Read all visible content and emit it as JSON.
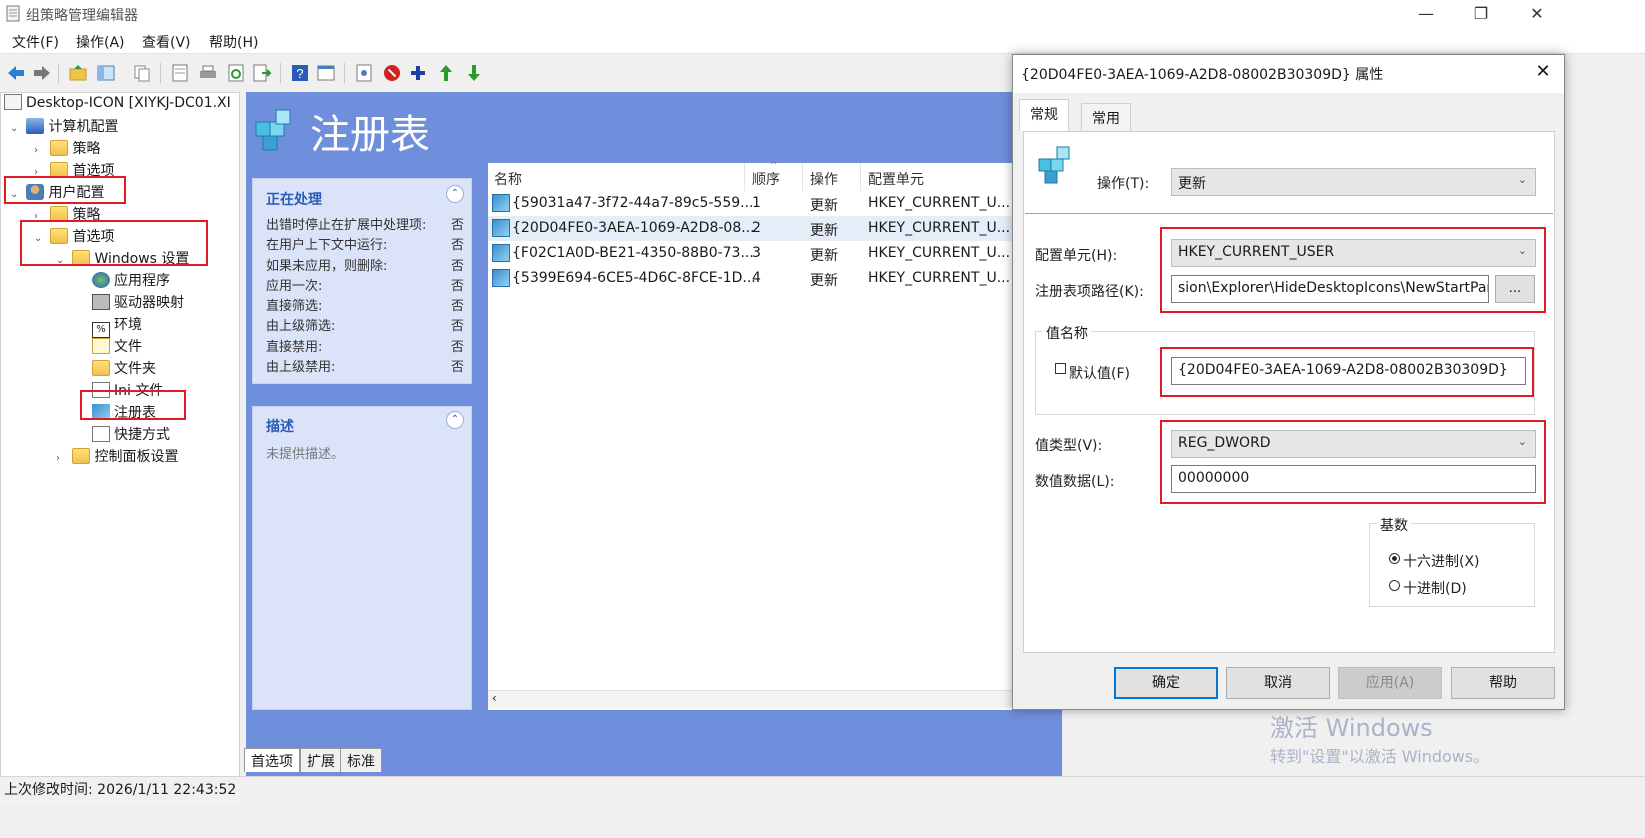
{
  "window": {
    "title": "组策略管理编辑器",
    "minimize": "—",
    "restore": "❐",
    "close": "✕"
  },
  "menu": [
    "文件(F)",
    "操作(A)",
    "查看(V)",
    "帮助(H)"
  ],
  "toolbar_icons": [
    "back-arrow-icon",
    "forward-arrow-icon",
    "up-folder-icon",
    "show-hide-tree-icon",
    "copy-icon",
    "properties-icon",
    "print-icon",
    "refresh-icon",
    "export-icon",
    "help-icon",
    "view-icon",
    "document-properties-icon",
    "stop-icon",
    "add-icon",
    "move-up-icon",
    "move-down-icon"
  ],
  "tree": {
    "root": "Desktop-ICON [XIYKJ-DC01.XI",
    "computer_config": "计算机配置",
    "cc_policies": "策略",
    "cc_prefs": "首选项",
    "user_config": "用户配置",
    "uc_policies": "策略",
    "uc_prefs": "首选项",
    "windows_settings": "Windows 设置",
    "applications": "应用程序",
    "drive_maps": "驱动器映射",
    "environment": "环境",
    "files": "文件",
    "folders": "文件夹",
    "ini_files": "Ini 文件",
    "registry": "注册表",
    "shortcuts": "快捷方式",
    "control_panel": "控制面板设置"
  },
  "main": {
    "title": "注册表",
    "processing": {
      "header": "正在处理",
      "rows": [
        {
          "label": "出错时停止在扩展中处理项:",
          "value": "否"
        },
        {
          "label": "在用户上下文中运行:",
          "value": "否"
        },
        {
          "label": "如果未应用，则删除:",
          "value": "否"
        },
        {
          "label": "应用一次:",
          "value": "否"
        },
        {
          "label": "直接筛选:",
          "value": "否"
        },
        {
          "label": "由上级筛选:",
          "value": "否"
        },
        {
          "label": "直接禁用:",
          "value": "否"
        },
        {
          "label": "由上级禁用:",
          "value": "否"
        }
      ]
    },
    "description": {
      "header": "描述",
      "text": "未提供描述。"
    },
    "list": {
      "columns": [
        "名称",
        "顺序",
        "操作",
        "配置单元"
      ],
      "rows": [
        {
          "name": "{59031a47-3f72-44a7-89c5-559...",
          "order": "1",
          "action": "更新",
          "hive": "HKEY_CURRENT_U..."
        },
        {
          "name": "{20D04FE0-3AEA-1069-A2D8-08...",
          "order": "2",
          "action": "更新",
          "hive": "HKEY_CURRENT_U..."
        },
        {
          "name": "{F02C1A0D-BE21-4350-88B0-73...",
          "order": "3",
          "action": "更新",
          "hive": "HKEY_CURRENT_U..."
        },
        {
          "name": "{5399E694-6CE5-4D6C-8FCE-1D...",
          "order": "4",
          "action": "更新",
          "hive": "HKEY_CURRENT_U..."
        }
      ]
    }
  },
  "bottom_tabs": [
    "首选项",
    "扩展",
    "标准"
  ],
  "status": "上次修改时间: 2026/1/11 22:43:52",
  "dialog": {
    "title": "{20D04FE0-3AEA-1069-A2D8-08002B30309D} 属性",
    "tabs": [
      "常规",
      "常用"
    ],
    "action_label": "操作(T):",
    "action_value": "更新",
    "hive_label": "配置单元(H):",
    "hive_value": "HKEY_CURRENT_USER",
    "keypath_label": "注册表项路径(K):",
    "keypath_value": "sion\\Explorer\\HideDesktopIcons\\NewStartPanel",
    "browse": "...",
    "value_name_group": "值名称",
    "default_value_label": "默认值(F)",
    "value_name": "{20D04FE0-3AEA-1069-A2D8-08002B30309D}",
    "value_type_label": "值类型(V):",
    "value_type": "REG_DWORD",
    "value_data_label": "数值数据(L):",
    "value_data": "00000000",
    "base_group": "基数",
    "hex_label": "十六进制(X)",
    "dec_label": "十进制(D)",
    "ok": "确定",
    "cancel": "取消",
    "apply": "应用(A)",
    "help": "帮助"
  },
  "watermark": {
    "line1": "激活 Windows",
    "line2": "转到\"设置\"以激活 Windows。"
  },
  "colors": {
    "highlight_red": "#e01b24",
    "main_blue": "#6f8fdc",
    "pane_header_blue": "#2b5bb8"
  }
}
